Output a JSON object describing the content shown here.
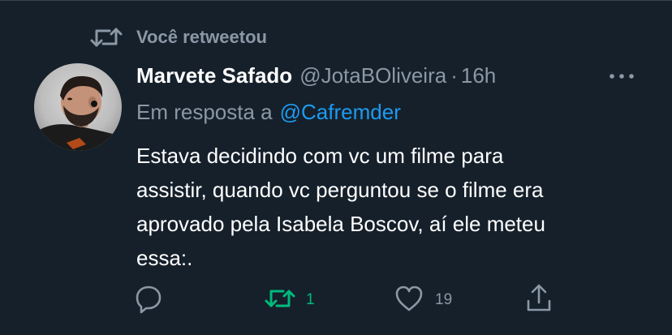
{
  "retweet_banner": {
    "text": "Você retweetou",
    "icon": "retweet-icon"
  },
  "tweet": {
    "display_name": "Marvete Safado",
    "handle": "@JotaBOliveira",
    "separator": "·",
    "time": "16h",
    "more_icon": "more-horizontal-icon",
    "reply_prefix": "Em resposta a",
    "reply_mention": "@Cafremder",
    "body_lines": [
      "Estava decidindo com vc um filme para",
      "assistir, quando vc perguntou se o filme era",
      "aprovado pela Isabela Boscov, aí ele meteu",
      "essa:."
    ]
  },
  "actions": {
    "reply": {
      "icon": "reply-icon",
      "count": ""
    },
    "retweet": {
      "icon": "retweet-icon",
      "count": "1",
      "active": true
    },
    "like": {
      "icon": "heart-icon",
      "count": "19"
    },
    "share": {
      "icon": "share-icon",
      "count": ""
    }
  },
  "colors": {
    "background": "#15202b",
    "primary_text": "#ffffff",
    "secondary_text": "#8b98a5",
    "link": "#1d9bf0",
    "retweet_active": "#00ba7c"
  }
}
